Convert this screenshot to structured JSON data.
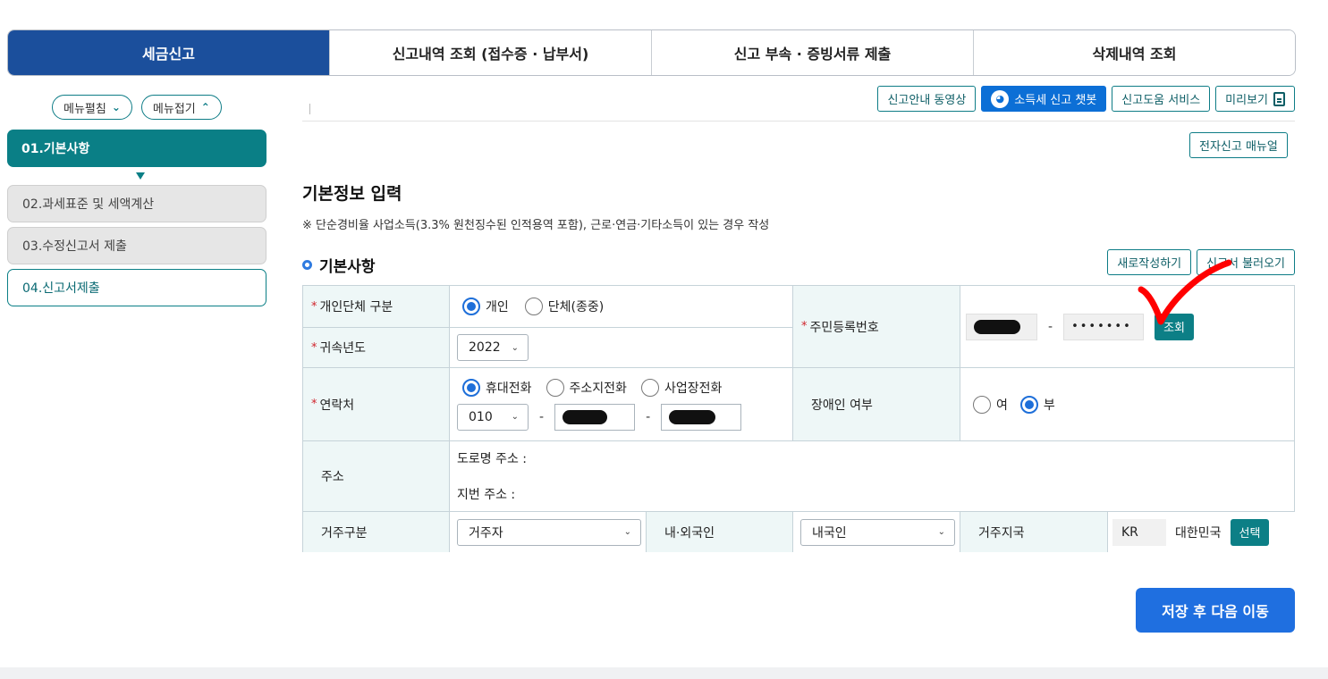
{
  "tabs": [
    "세금신고",
    "신고내역 조회 (접수증 · 납부서)",
    "신고 부속 · 증빙서류 제출",
    "삭제내역 조회"
  ],
  "sidebar": {
    "expand_label": "메뉴펼침",
    "collapse_label": "메뉴접기",
    "steps": [
      "01.기본사항",
      "02.과세표준 및 세액계산",
      "03.수정신고서 제출",
      "04.신고서제출"
    ]
  },
  "toolbar": {
    "video": "신고안내 동영상",
    "chatbot": "소득세 신고 챗봇",
    "help": "신고도움 서비스",
    "preview": "미리보기",
    "manual": "전자신고 매뉴얼"
  },
  "page": {
    "title": "기본정보 입력",
    "note": "※ 단순경비율 사업소득(3.3% 원천징수된 인적용역 포함), 근로·연금·기타소득이 있는 경우 작성",
    "section": "기본사항",
    "new_btn": "새로작성하기",
    "load_btn": "신고서 불러오기"
  },
  "form": {
    "type_label": "개인단체 구분",
    "type_opts": [
      "개인",
      "단체(종중)"
    ],
    "year_label": "귀속년도",
    "year_value": "2022",
    "rrn_label": "주민등록번호",
    "rrn_masked": "•••••••",
    "rrn_sep": "-",
    "lookup_btn": "조회",
    "contact_label": "연락처",
    "phone_opts": [
      "휴대전화",
      "주소지전화",
      "사업장전화"
    ],
    "phone_prefix": "010",
    "phone_sep": "-",
    "disabled_label": "장애인 여부",
    "disabled_opts": [
      "여",
      "부"
    ],
    "address_label": "주소",
    "road_addr": "도로명 주소 :",
    "lot_addr": "지번 주소 :",
    "residency_label": "거주구분",
    "residency_value": "거주자",
    "nationality_label": "내·외국인",
    "nationality_value": "내국인",
    "country_label": "거주지국",
    "country_code": "KR",
    "country_name": "대한민국",
    "select_btn": "선택"
  },
  "save_btn": "저장 후 다음 이동",
  "colors": {
    "tab_active": "#1b4f9c",
    "teal": "#0a7f86",
    "primary": "#1f6fe0",
    "annotation": "#ff0000"
  }
}
